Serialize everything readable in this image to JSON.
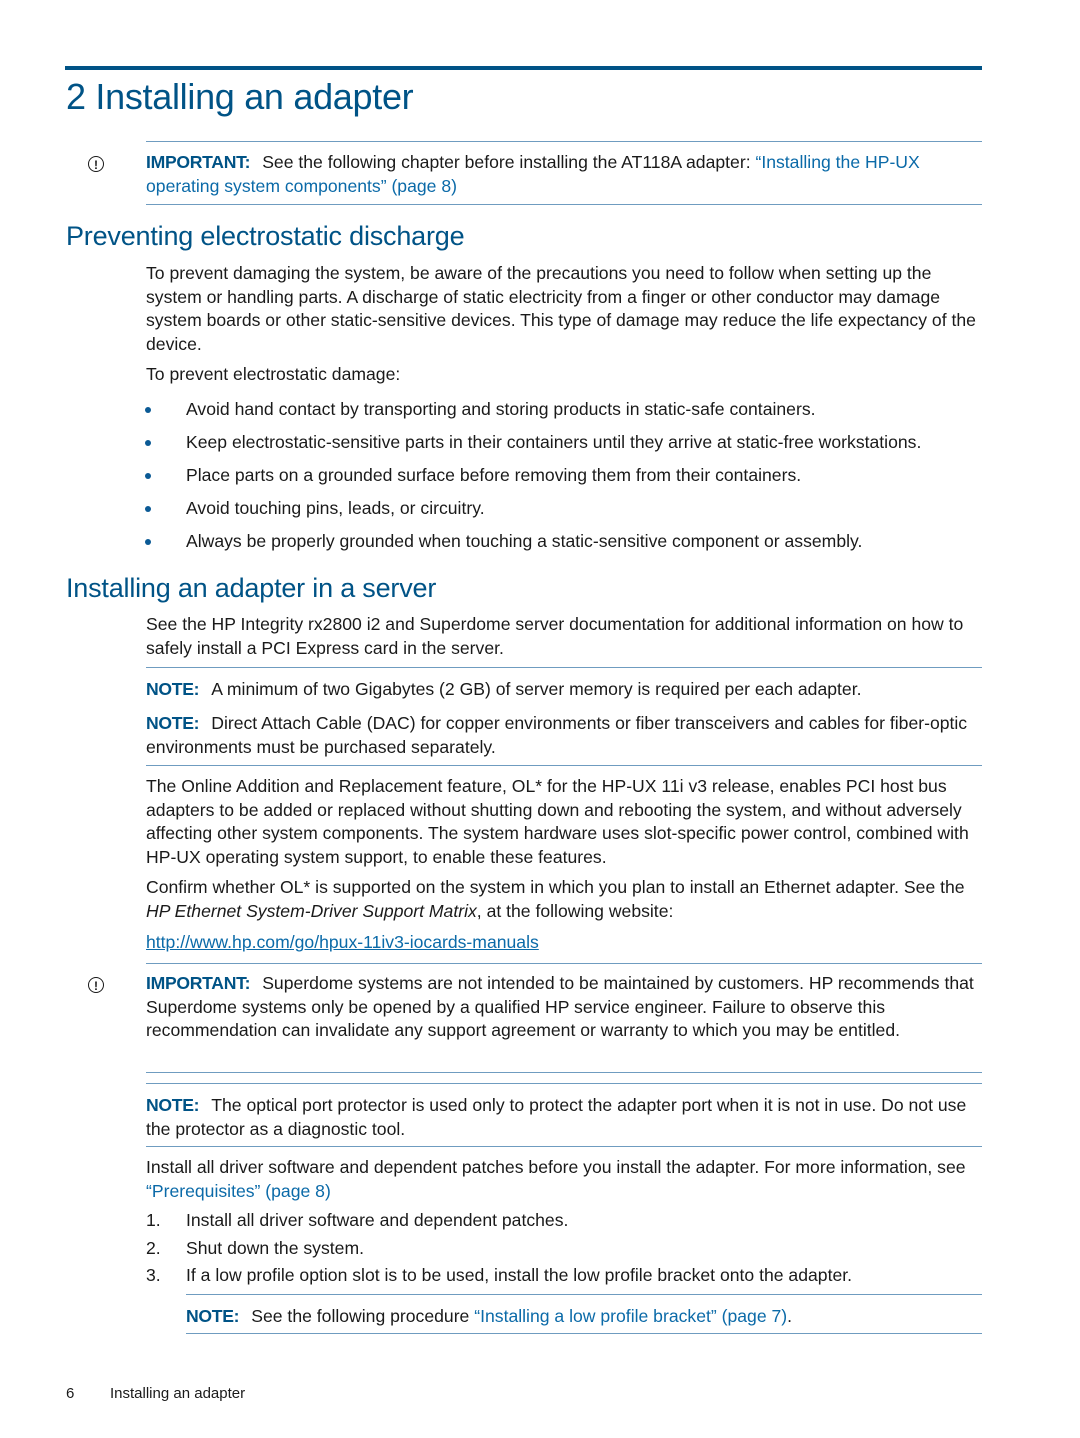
{
  "chapter": {
    "number": "2",
    "title": "2 Installing an adapter"
  },
  "important_1": {
    "label": "IMPORTANT:",
    "text": "See the following chapter before installing the AT118A adapter: ",
    "link": "“Installing the HP-UX operating system components” (page 8)"
  },
  "section_esd": {
    "heading": "Preventing electrostatic discharge",
    "para1": "To prevent damaging the system, be aware of the precautions you need to follow when setting up the system or handling parts. A discharge of static electricity from a finger or other conductor may damage system boards or other static-sensitive devices. This type of damage may reduce the life expectancy of the device.",
    "para2": "To prevent electrostatic damage:",
    "bullets": [
      "Avoid hand contact by transporting and storing products in static-safe containers.",
      "Keep electrostatic-sensitive parts in their containers until they arrive at static-free workstations.",
      "Place parts on a grounded surface before removing them from their containers.",
      "Avoid touching pins, leads, or circuitry.",
      "Always be properly grounded when touching a static-sensitive component or assembly."
    ]
  },
  "section_server": {
    "heading": "Installing an adapter in a server",
    "para1": "See the HP Integrity rx2800 i2 and Superdome server documentation for additional information on how to safely install a PCI Express card in the server.",
    "note1": {
      "label": "NOTE:",
      "text": "A minimum of two Gigabytes (2 GB) of server memory is required per each adapter."
    },
    "note2": {
      "label": "NOTE:",
      "text": "Direct Attach Cable (DAC) for copper environments or fiber transceivers and cables for fiber-optic environments must be purchased separately."
    },
    "para2": "The Online Addition and Replacement feature, OL* for the HP-UX 11i v3 release, enables PCI host bus adapters to be added or replaced without shutting down and rebooting the system, and without adversely affecting other system components. The system hardware uses slot-specific power control, combined with HP-UX operating system support, to enable these features.",
    "para3_a": "Confirm whether OL* is supported on the system in which you plan to install an Ethernet adapter. See the ",
    "para3_em": "HP Ethernet System-Driver Support Matrix",
    "para3_b": ", at the following website:",
    "url": "http://www.hp.com/go/hpux-11iv3-iocards-manuals",
    "important_2": {
      "label": "IMPORTANT:",
      "text": "Superdome systems are not intended to be maintained by customers. HP recommends that Superdome systems only be opened by a qualified HP service engineer. Failure to observe this recommendation can invalidate any support agreement or warranty to which you may be entitled."
    },
    "note3": {
      "label": "NOTE:",
      "text": "The optical port protector is used only to protect the adapter port when it is not in use. Do not use the protector as a diagnostic tool."
    },
    "para4_a": "Install all driver software and dependent patches before you install the adapter. For more information, see ",
    "para4_link": "“Prerequisites” (page 8)",
    "steps": [
      {
        "num": "1.",
        "text": "Install all driver software and dependent patches."
      },
      {
        "num": "2.",
        "text": "Shut down the system."
      },
      {
        "num": "3.",
        "text": "If a low profile option slot is to be used, install the low profile bracket onto the adapter."
      }
    ],
    "note4": {
      "label": "NOTE:",
      "text": "See the following procedure ",
      "link": "“Installing a low profile bracket” (page 7)",
      "tail": "."
    }
  },
  "footer": {
    "page_number": "6",
    "running_title": "Installing an adapter"
  },
  "icons": {
    "important": "exclamation-circle-icon",
    "bullet": "bullet-dot-icon"
  },
  "colors": {
    "heading": "#005386",
    "link": "#0b6aa8",
    "rule": "#6f9cc0",
    "text": "#1a1a1a"
  }
}
